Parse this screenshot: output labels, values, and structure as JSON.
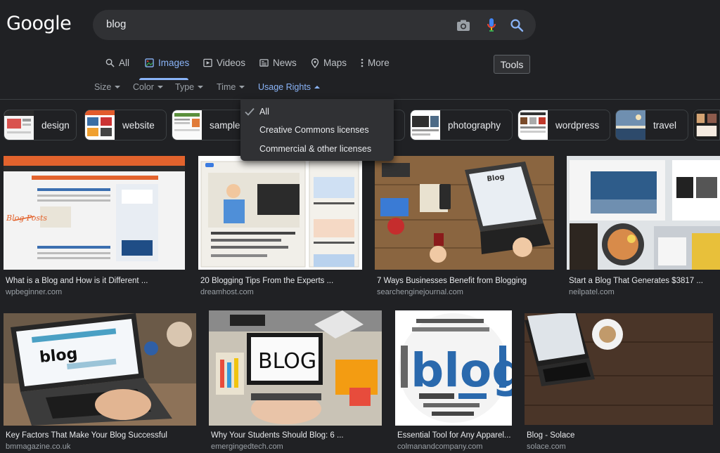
{
  "logo": "Google",
  "search": {
    "query": "blog"
  },
  "tabs": [
    {
      "label": "All",
      "icon": "search-icon",
      "active": false
    },
    {
      "label": "Images",
      "icon": "images-icon",
      "active": true
    },
    {
      "label": "Videos",
      "icon": "video-icon",
      "active": false
    },
    {
      "label": "News",
      "icon": "news-icon",
      "active": false
    },
    {
      "label": "Maps",
      "icon": "map-pin-icon",
      "active": false
    },
    {
      "label": "More",
      "icon": "more-dots-icon",
      "active": false
    }
  ],
  "tools_label": "Tools",
  "filters": [
    {
      "label": "Size"
    },
    {
      "label": "Color"
    },
    {
      "label": "Type"
    },
    {
      "label": "Time"
    },
    {
      "label": "Usage Rights"
    }
  ],
  "chips": [
    {
      "label": "design"
    },
    {
      "label": "website"
    },
    {
      "label": "sample"
    },
    {
      "label": "photography"
    },
    {
      "label": "wordpress"
    },
    {
      "label": "travel"
    }
  ],
  "usage_rights_menu": {
    "selected": "All",
    "items": [
      "All",
      "Creative Commons licenses",
      "Commercial & other licenses"
    ]
  },
  "results": [
    {
      "title": "What is a Blog and How is it Different ...",
      "site": "wpbeginner.com",
      "image_text": "Blog Posts"
    },
    {
      "title": "20 Blogging Tips From the Experts ...",
      "site": "dreamhost.com"
    },
    {
      "title": "7 Ways Businesses Benefit from Blogging",
      "site": "searchenginejournal.com",
      "image_text": "Blog"
    },
    {
      "title": "Start a Blog That Generates $3817 ...",
      "site": "neilpatel.com"
    },
    {
      "title": "Key Factors That Make Your Blog Successful",
      "site": "bmmagazine.co.uk",
      "image_text": "blog"
    },
    {
      "title": "Why Your Students Should Blog: 6 ...",
      "site": "emergingedtech.com",
      "image_text": "BLOG"
    },
    {
      "title": "Essential Tool for Any Apparel...",
      "site": "colmanandcompany.com",
      "image_text": "blog"
    },
    {
      "title": "Blog - Solace",
      "site": "solace.com"
    }
  ],
  "colors": {
    "background": "#202124",
    "accent": "#8ab4f8",
    "surface": "#303134"
  }
}
